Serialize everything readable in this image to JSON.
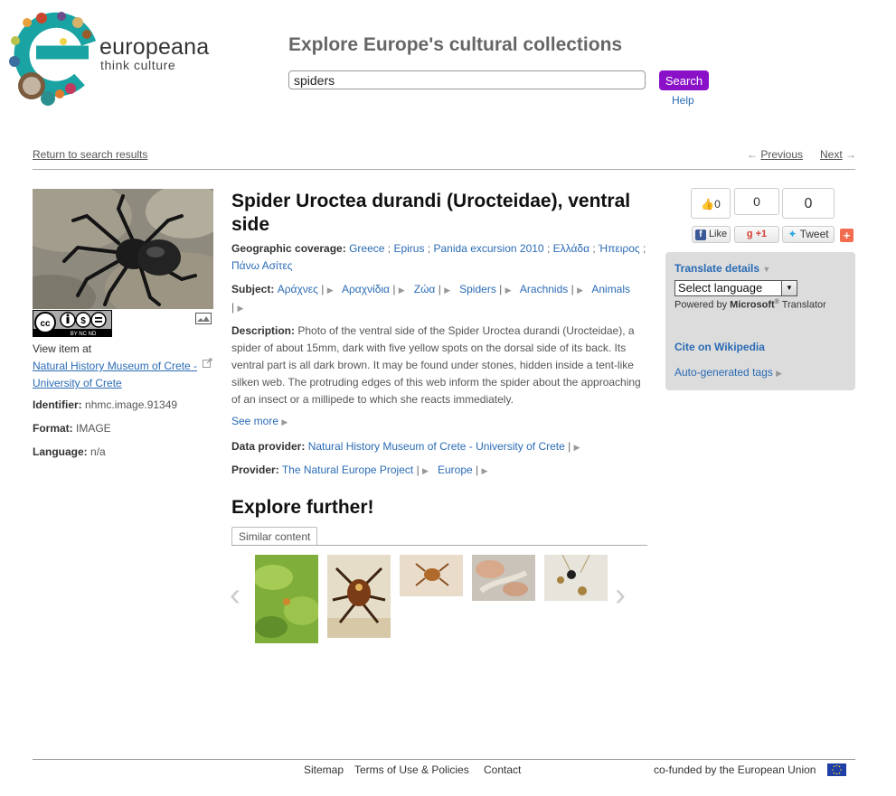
{
  "header": {
    "logo_word": "europeana",
    "logo_tagline": "think culture",
    "title": "Explore Europe's cultural collections",
    "search_value": "spiders",
    "search_button": "Search",
    "help": "Help"
  },
  "nav": {
    "return": "Return to search results",
    "previous": "Previous",
    "next": "Next"
  },
  "left": {
    "view_item_at": "View item at",
    "provider_link": "Natural History Museum of Crete - University of Crete",
    "identifier_label": "Identifier:",
    "identifier_value": "nhmc.image.91349",
    "format_label": "Format:",
    "format_value": "IMAGE",
    "language_label": "Language:",
    "language_value": "n/a",
    "license_text": "BY NC ND"
  },
  "item": {
    "title": "Spider Uroctea durandi (Urocteidae), ventral side",
    "geo_label": "Geographic coverage:",
    "geo_values": [
      "Greece",
      "Epirus",
      "Panida excursion 2010",
      "Ελλάδα",
      "Ήπειρος",
      "Πάνω Ασίτες"
    ],
    "subject_label": "Subject:",
    "subject_values": [
      "Αράχνες",
      "Αραχνίδια",
      "Ζώα",
      "Spiders",
      "Arachnids",
      "Animals"
    ],
    "description_label": "Description:",
    "description": "Photo of the ventral side of the Spider Uroctea durandi (Urocteidae), a spider of about 15mm, dark with five yellow spots on the dorsal side of its back. Its ventral part is all dark brown. It may be found under stones, hidden inside a tent-like silken web. The protruding edges of this web inform the spider about the approaching of an insect or a millipede to which she reacts immediately.",
    "see_more": "See more",
    "data_provider_label": "Data provider:",
    "data_provider_value": "Natural History Museum of Crete - University of Crete",
    "provider_label": "Provider:",
    "provider_values": [
      "The Natural Europe Project",
      "Europe"
    ]
  },
  "explore": {
    "title": "Explore further!",
    "tab": "Similar content"
  },
  "social": {
    "like_count": "0",
    "gplus_count": "0",
    "tweet_count": "0",
    "like_label": "Like",
    "gplus_label": "+1",
    "tweet_label": "Tweet"
  },
  "translate": {
    "title": "Translate details",
    "select_value": "Select language",
    "powered_prefix": "Powered by",
    "powered_brand": "Microsoft",
    "powered_suffix": "Translator",
    "cite": "Cite on Wikipedia",
    "auto_tags": "Auto-generated tags"
  },
  "footer": {
    "sitemap": "Sitemap",
    "terms": "Terms of Use & Policies",
    "contact": "Contact",
    "cofunded": "co-funded by the European Union"
  },
  "colors": {
    "accent_purple": "#8a11c8",
    "link_blue": "#2a6bb5",
    "logo_teal": "#1aa3a3"
  }
}
